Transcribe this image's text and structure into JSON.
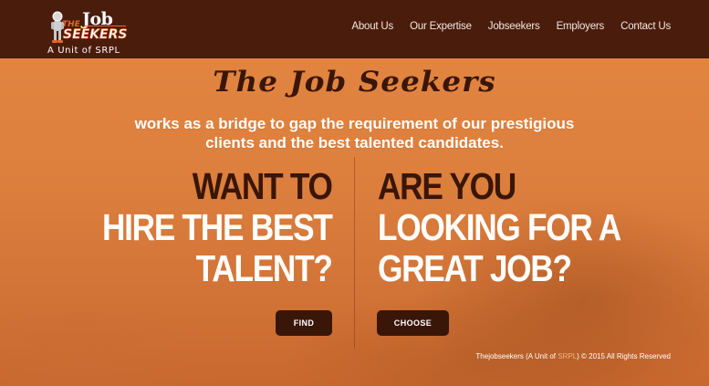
{
  "nav": {
    "logo": {
      "the": "THE",
      "job": "Job",
      "seekers": "SEEKERS",
      "unit": "A Unit of SRPL"
    },
    "links": [
      "About Us",
      "Our Expertise",
      "Jobseekers",
      "Employers",
      "Contact Us"
    ]
  },
  "hero": {
    "headline": "The Job Seekers",
    "tagline_line1": "works as a bridge to gap the requirement of our prestigious",
    "tagline_line2": "clients and the best talented candidates.",
    "left": {
      "line1": "WANT TO",
      "line2": "HIRE THE BEST",
      "line3": "TALENT?",
      "button": "FIND"
    },
    "right": {
      "line1": "ARE YOU",
      "line2": "LOOKING FOR A",
      "line3": "GREAT JOB?",
      "button": "CHOOSE"
    }
  },
  "footer": {
    "prefix": "Thejobseekers (A Unit of ",
    "brand": "SRPL",
    "suffix": ") © 2015 All Rights Reserved"
  },
  "colors": {
    "nav_bg": "#4a1c0c",
    "hero_bg": "#dd7f3d",
    "dark_text": "#3a1609",
    "accent": "#e8652a"
  }
}
